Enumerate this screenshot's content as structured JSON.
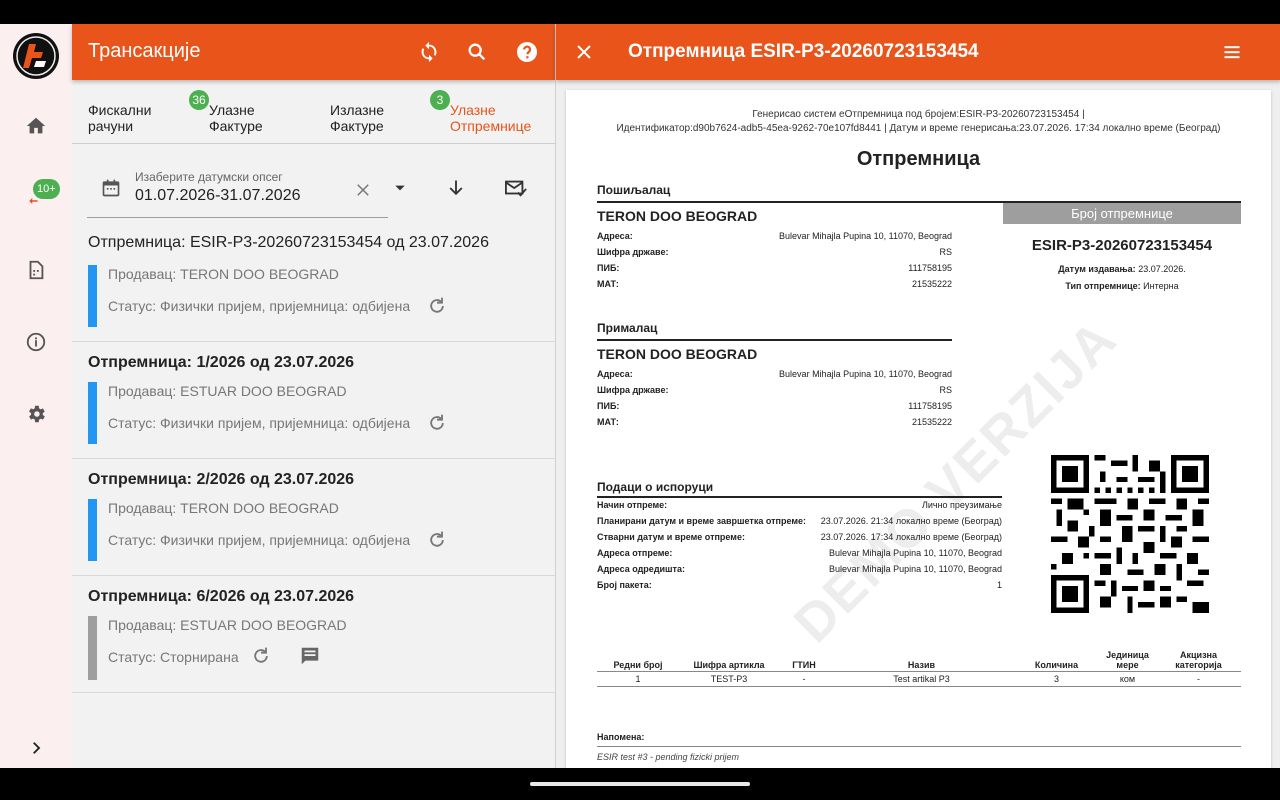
{
  "left_panel": {
    "title": "Трансакције",
    "tabs": [
      {
        "label": "Фискални\nрачуни",
        "badge": ""
      },
      {
        "label": "Улазне\nФактуре",
        "badge": "36"
      },
      {
        "label": "Излазне\nФактуре",
        "badge": ""
      },
      {
        "label": "Улазне\nОтпремнице",
        "badge": "3"
      }
    ],
    "date_filter": {
      "label": "Изаберите датумски опсег",
      "value": "01.07.2026-31.07.2026"
    },
    "items": [
      {
        "title": "Отпремница: ESIR-P3-20260723153454 од 23.07.2026",
        "seller": "Продавац: TERON DOO BEOGRAD",
        "status": "Статус: Физички пријем, пријемница: одбијена",
        "bar_color": "#2196f3",
        "bold": false,
        "has_comment": false
      },
      {
        "title": "Отпремница: 1/2026 од 23.07.2026",
        "seller": "Продавац: ESTUAR DOO BEOGRAD",
        "status": "Статус: Физички пријем, пријемница: одбијена",
        "bar_color": "#2196f3",
        "bold": true,
        "has_comment": false
      },
      {
        "title": "Отпремница: 2/2026 од 23.07.2026",
        "seller": "Продавац: TERON DOO BEOGRAD",
        "status": "Статус: Физички пријем, пријемница: одбијена",
        "bar_color": "#2196f3",
        "bold": true,
        "has_comment": false
      },
      {
        "title": "Отпремница: 6/2026 од 23.07.2026",
        "seller": "Продавац: ESTUAR DOO BEOGRAD",
        "status": "Статус: Сторнирана",
        "bar_color": "#9e9e9e",
        "bold": true,
        "has_comment": true
      }
    ]
  },
  "rail": {
    "badge": "10+"
  },
  "right_panel": {
    "title": "Отпремница ESIR-P3-20260723153454",
    "doc": {
      "header_line1": "Генерисао систем еОтпремница под бројем:ESIR-P3-20260723153454 |",
      "header_line2": "Идентификатор:d90b7624-adb5-45ea-9262-70e107fd8441 | Датум и време генерисања:23.07.2026. 17:34 локално време (Београд)",
      "title": "Отпремница",
      "sender": {
        "heading": "Пошиљалац",
        "name": "TERON DOO BEOGRAD",
        "rows": [
          {
            "k": "Адреса:",
            "v": "Bulevar Mihajla Pupina 10, 11070, Beograd"
          },
          {
            "k": "Шифра државе:",
            "v": "RS"
          },
          {
            "k": "ПИБ:",
            "v": "111758195"
          },
          {
            "k": "МАТ:",
            "v": "21535222"
          }
        ]
      },
      "receiver": {
        "heading": "Прималац",
        "name": "TERON DOO BEOGRAD",
        "rows": [
          {
            "k": "Адреса:",
            "v": "Bulevar Mihajla Pupina 10, 11070, Beograd"
          },
          {
            "k": "Шифра државе:",
            "v": "RS"
          },
          {
            "k": "ПИБ:",
            "v": "111758195"
          },
          {
            "k": "МАТ:",
            "v": "21535222"
          }
        ]
      },
      "number_box": {
        "label": "Број отпремнице",
        "value": "ESIR-P3-20260723153454",
        "issue_date_label": "Датум издавања:",
        "issue_date": "23.07.2026.",
        "type_label": "Тип отпремнице:",
        "type": "Интерна"
      },
      "watermark": "DEMO VERZIJA",
      "delivery": {
        "heading": "Подаци о испоруци",
        "rows": [
          {
            "k": "Начин отпреме:",
            "v": "Лично преузимање"
          },
          {
            "k": "Планирани датум и време завршетка отпреме:",
            "v": "23.07.2026. 21:34 локално време (Београд)"
          },
          {
            "k": "Стварни датум и време отпреме:",
            "v": "23.07.2026. 17:34 локално време (Београд)"
          },
          {
            "k": "Адреса отпреме:",
            "v": "Bulevar Mihajla Pupina 10, 11070, Beograd"
          },
          {
            "k": "Адреса одредишта:",
            "v": "Bulevar Mihajla Pupina 10, 11070, Beograd"
          },
          {
            "k": "Број пакета:",
            "v": "1"
          }
        ]
      },
      "table": {
        "headers": [
          "Редни број",
          "Шифра артикла",
          "ГТИН",
          "Назив",
          "Количина",
          "Јединица мере",
          "Акцизна категорија"
        ],
        "rows": [
          [
            "1",
            "TEST-P3",
            "-",
            "Test artikal P3",
            "3",
            "ком",
            "-"
          ]
        ]
      },
      "note_label": "Напомена:",
      "note": "ESIR test #3 - pending fizicki prijem"
    }
  },
  "colors": {
    "accent": "#e8541a",
    "badge": "#4caf50",
    "bar_blue": "#2196f3",
    "bar_grey": "#9e9e9e"
  }
}
